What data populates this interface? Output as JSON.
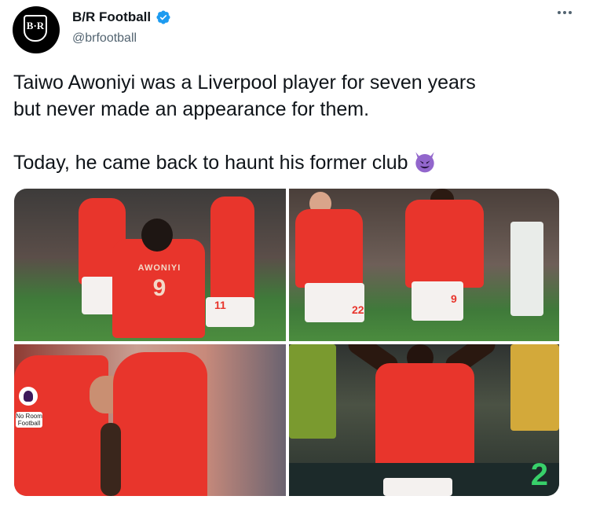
{
  "account": {
    "name": "B/R Football",
    "handle": "@brfootball",
    "avatar_text": "B·R",
    "verified_color": "#1d9bf0"
  },
  "tweet": {
    "line1": "Taiwo Awoniyi was a Liverpool player for seven years\nbut never made an appearance for them.",
    "line2": "Today, he came back to haunt his former club",
    "emoji_name": "smiling-face-with-horns"
  },
  "media": {
    "photo1": {
      "jersey_name": "AWONIYI",
      "jersey_number": "9",
      "other_number": "11"
    },
    "photo2": {
      "shirt_number_left": "22",
      "shirt_number_right": "9"
    },
    "photo3": {
      "sponsor_text": "No Room\nFootball"
    },
    "photo4": {
      "wall_glyph": "2"
    }
  },
  "colors": {
    "brand_red": "#e8352c",
    "text_primary": "#0f1419",
    "text_secondary": "#536471"
  }
}
